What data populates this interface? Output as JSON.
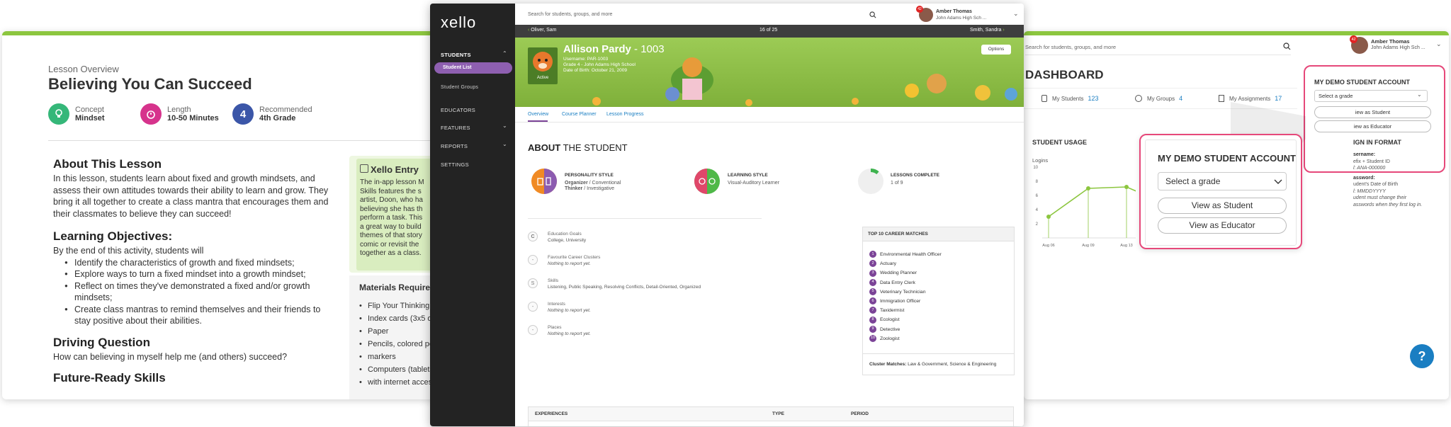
{
  "lesson": {
    "overview_label": "Lesson Overview",
    "title": "Believing You Can Succeed",
    "meta": [
      {
        "icon": "lightbulb-icon",
        "label": "Concept",
        "value": "Mindset",
        "color": "#35b779"
      },
      {
        "icon": "stopwatch-icon",
        "label": "Length",
        "value": "10-50 Minutes",
        "color": "#d6338c"
      },
      {
        "icon": "number-4-icon",
        "label": "Recommended",
        "value": "4th Grade",
        "color": "#3b56a8",
        "glyph": "4"
      }
    ],
    "about_heading": "About This Lesson",
    "about_text": "In this lesson, students learn about fixed and growth mindsets, and assess their own attitudes towards their ability to learn and grow. They bring it all together to create a class mantra that encourages them and their classmates to believe they can succeed!",
    "objectives_heading": "Learning Objectives:",
    "objectives_intro": "By the end of this activity, students will",
    "objectives": [
      "Identify the characteristics of growth and fixed mindsets;",
      "Explore ways to turn a fixed mindset into a growth mindset;",
      "Reflect on times they've demonstrated a fixed and/or growth mindsets;",
      "Create class mantras to remind themselves and their friends to stay positive about their abilities."
    ],
    "driving_heading": "Driving Question",
    "driving_text": "How can believing in myself help me (and others) succeed?",
    "future_heading": "Future-Ready Skills",
    "entry": {
      "title": "Xello Entry",
      "lines": [
        "The in-app lesson M",
        "Skills features the s",
        "artist, Doon, who ha",
        "believing she has th",
        "perform a task. This",
        "a great way to build",
        "themes of that story",
        "comic or revisit the",
        "together as a class."
      ]
    },
    "materials_heading": "Materials Required",
    "materials": [
      "Flip Your Thinking c",
      "Index cards (3x5 or",
      "Paper",
      "Pencils, colored per",
      "markers",
      "Computers (tablets,",
      "with internet access"
    ]
  },
  "app": {
    "logo": "xello",
    "search_placeholder": "Search for students, groups, and more",
    "user_name": "Amber Thomas",
    "user_school": "John Adams High Sch ...",
    "badge": "42",
    "nav": {
      "students": "STUDENTS",
      "student_list": "Student List",
      "student_groups": "Student Groups",
      "educators": "EDUCATORS",
      "features": "FEATURES",
      "reports": "REPORTS",
      "settings": "SETTINGS"
    },
    "pager": {
      "prev": "Oliver, Sam",
      "position": "16 of 25",
      "next": "Smith, Sandra"
    },
    "student": {
      "name": "Allison Pardy",
      "id": " - 1003",
      "username": "Username: PAR-1003",
      "grade": "Grade 4 - John Adams High School",
      "dob": "Date of Birth: October 21, 2009",
      "status": "Active",
      "options": "Options"
    },
    "tabs": [
      "Overview",
      "Course Planner",
      "Lesson Progress"
    ],
    "about_bold": "ABOUT",
    "about_rest": " THE STUDENT",
    "personality": {
      "title": "PERSONALITY STYLE",
      "line1_bold": "Organizer",
      "line1_rest": " / Conventional",
      "line2_bold": "Thinker",
      "line2_rest": " / Investigative"
    },
    "learning": {
      "title": "LEARNING STYLE",
      "value": "Visual-Auditory Learner"
    },
    "lessons": {
      "title": "LESSONS COMPLETE",
      "value": "1 of 9",
      "complete": 1,
      "total": 9
    },
    "details": [
      {
        "icon": "graduation-cap-icon",
        "glyph": "C",
        "label": "Education Goals",
        "value": "College, University",
        "italic": false
      },
      {
        "icon": "career-cluster-icon",
        "glyph": "-",
        "label": "Favourite Career Clusters",
        "value": "Nothing to report yet.",
        "italic": true
      },
      {
        "icon": "skills-badge-icon",
        "glyph": "S",
        "label": "Skills",
        "value": "Listening, Public Speaking, Resolving Conflicts, Detail-Oriented, Organized",
        "italic": false
      },
      {
        "icon": "interests-icon",
        "glyph": "-",
        "label": "Interests",
        "value": "Nothing to report yet.",
        "italic": true
      },
      {
        "icon": "places-icon",
        "glyph": "-",
        "label": "Places",
        "value": "Nothing to report yet.",
        "italic": true
      }
    ],
    "career_heading": "TOP 10 CAREER MATCHES",
    "careers": [
      "Environmental Health Officer",
      "Actuary",
      "Wedding Planner",
      "Data Entry Clerk",
      "Veterinary Technician",
      "Immigration Officer",
      "Taxidermist",
      "Ecologist",
      "Detective",
      "Zoologist"
    ],
    "cluster_label": "Cluster Matches:",
    "cluster_value": " Law & Government, Science & Engineering",
    "experiences": {
      "col1": "EXPERIENCES",
      "col2": "TYPE",
      "col3": "PERIOD"
    }
  },
  "dashboard": {
    "search_placeholder": "Search for students, groups, and more",
    "user_name": "Amber Thomas",
    "user_school": "John Adams High Sch ...",
    "badge": "42",
    "title": "DASHBOARD",
    "stats": [
      {
        "icon": "students-icon",
        "label": "My Students",
        "value": "123"
      },
      {
        "icon": "groups-icon",
        "label": "My Groups",
        "value": "4"
      },
      {
        "icon": "assignments-icon",
        "label": "My Assignments",
        "value": "17"
      }
    ],
    "usage_heading": "STUDENT USAGE",
    "logins_label": "Logins",
    "demo_title": "MY DEMO STUDENT ACCOUNT",
    "select_grade": "Select a grade",
    "view_student": "View as Student",
    "view_educator": "View as Educator",
    "view_student_partial": "iew as Student",
    "view_educator_partial": "iew as Educator",
    "signin_heading": "IGN IN FORMAT",
    "signin_lines": [
      {
        "text": "sername:",
        "bold": true
      },
      {
        "text": "efix + Student ID",
        "bold": false
      },
      {
        "text": "l: ANA-000000",
        "bold": false,
        "italic": true
      },
      {
        "text": "assword:",
        "bold": true
      },
      {
        "text": "udent's Date of Birth",
        "bold": false
      },
      {
        "text": "l: MMDDYYYY",
        "bold": false,
        "italic": true
      },
      {
        "text": "udent must change their",
        "bold": false,
        "italic": true
      },
      {
        "text": "asswords when they first log in.",
        "bold": false,
        "italic": true
      }
    ],
    "help": "?"
  },
  "chart_data": {
    "type": "line",
    "title": "STUDENT USAGE",
    "ylabel": "Logins",
    "ylim": [
      0,
      10
    ],
    "yticks": [
      2,
      4,
      6,
      8,
      10
    ],
    "categories": [
      "Aug 06",
      "Aug 09",
      "Aug 13"
    ],
    "values": [
      3,
      7,
      7.2
    ],
    "color": "#8cc63f"
  }
}
